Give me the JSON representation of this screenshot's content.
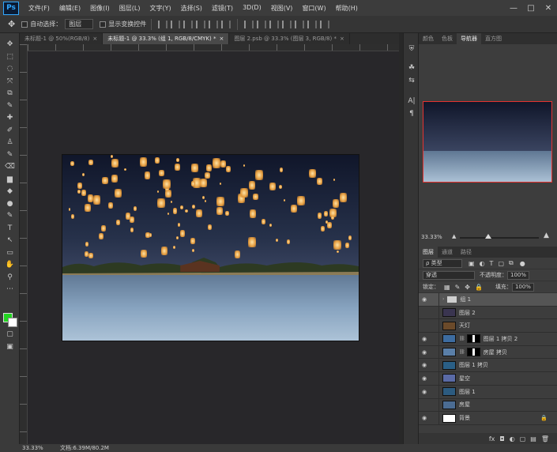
{
  "app": {
    "logo": "Ps",
    "menu": [
      "文件(F)",
      "编辑(E)",
      "图像(I)",
      "图层(L)",
      "文字(Y)",
      "选择(S)",
      "滤镜(T)",
      "3D(D)",
      "视图(V)",
      "窗口(W)",
      "帮助(H)"
    ],
    "window_controls": [
      "—",
      "□",
      "✕"
    ]
  },
  "options": {
    "auto_select_label": "自动选择：",
    "auto_select_value": "图层",
    "show_transform_label": "显示变换控件"
  },
  "tabs": [
    {
      "label": "未标题-1 @ 50%(RGB/8)",
      "active": false
    },
    {
      "label": "未标题-1 @ 33.3% (组 1, RGB/8/CMYK) *",
      "active": true
    },
    {
      "label": "图层 2.psb @ 33.3% (图层 3, RGB/8) *",
      "active": false
    }
  ],
  "tab_close": "×",
  "tools": [
    "✥",
    "⬚",
    "◌",
    "⤧",
    "⧉",
    "✎",
    "✚",
    "✐",
    "♙",
    "✎",
    "⌫",
    "▆",
    "◆",
    "●",
    "✎",
    "T",
    "↖",
    "▭",
    "✋",
    "⚲",
    "⋯"
  ],
  "colors": {
    "foreground": "#22d321",
    "background": "#ffffff",
    "nav_proxy": "#e4322f"
  },
  "dock_icons": [
    "⛨",
    "☘",
    "⇆",
    "A|",
    "¶"
  ],
  "navigator": {
    "tabs": [
      "颜色",
      "色板",
      "导航器",
      "直方图"
    ],
    "active_tab": "导航器",
    "zoom": "33.33%",
    "slider_percent": 36
  },
  "layers_panel": {
    "tabs": [
      "图层",
      "通道",
      "路径"
    ],
    "filter_label": "ρ 类型",
    "blend_mode": "穿透",
    "opacity_label": "不透明度：",
    "opacity_value": "100%",
    "lock_label": "锁定：",
    "fill_label": "填充：",
    "fill_value": "100%",
    "layers": [
      {
        "name": "组 1",
        "visible": true,
        "type": "group",
        "selected": true
      },
      {
        "name": "图层 2",
        "visible": false,
        "type": "image",
        "thumb": "#3a3550"
      },
      {
        "name": "天灯",
        "visible": false,
        "type": "image",
        "thumb": "#6b4a2a"
      },
      {
        "name": "图层 1 拷贝 2",
        "visible": true,
        "type": "masked",
        "thumb": "#3d6ca0"
      },
      {
        "name": "房屋 拷贝",
        "visible": true,
        "type": "masked",
        "thumb": "#5a7fa8"
      },
      {
        "name": "图层 1 拷贝",
        "visible": true,
        "type": "image",
        "thumb": "#2a5f86"
      },
      {
        "name": "星空",
        "visible": true,
        "type": "image",
        "thumb": "#5a6aa6"
      },
      {
        "name": "图层 1",
        "visible": true,
        "type": "image",
        "thumb": "#2c5b80"
      },
      {
        "name": "房屋",
        "visible": false,
        "type": "image",
        "thumb": "#4b6c93"
      },
      {
        "name": "背景",
        "visible": true,
        "type": "background",
        "thumb": "#ffffff"
      }
    ],
    "footer_icons": [
      "fx",
      "◘",
      "◐",
      "▢",
      "▤",
      "🗑"
    ]
  },
  "status": {
    "zoom": "33.33%",
    "doc_size": "文档:6.39M/80.2M"
  }
}
